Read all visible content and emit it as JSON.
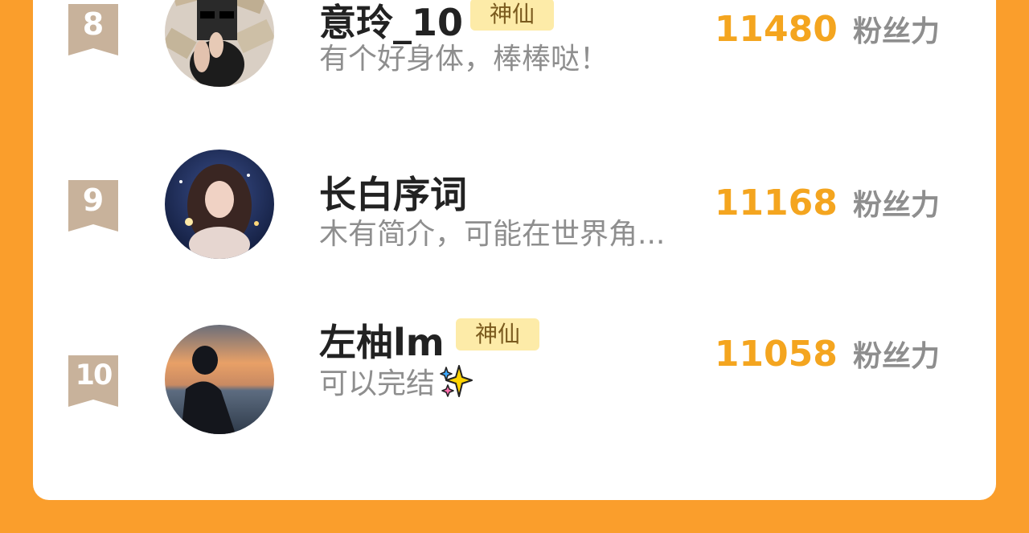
{
  "rows": [
    {
      "rank": "8",
      "name": "意玲_10",
      "tag": "神仙",
      "bio": "有个好身体，棒棒哒！",
      "count": "11480",
      "unit": "粉丝力"
    },
    {
      "rank": "9",
      "name": "长白序词",
      "tag": "",
      "bio": "木有简介，可能在世界角...",
      "count": "11168",
      "unit": "粉丝力"
    },
    {
      "rank": "10",
      "name": "左柚lm",
      "tag": "神仙",
      "bio": "可以完结",
      "count": "11058",
      "unit": "粉丝力"
    }
  ],
  "colors": {
    "background": "#FA9E2C",
    "card": "#FFFFFF",
    "rank_badge": "#C8B29B",
    "fan_count": "#F4A51F",
    "tag_bg": "#FDEBA8"
  },
  "icons": {
    "bio_emoji": "sparkles-icon"
  }
}
